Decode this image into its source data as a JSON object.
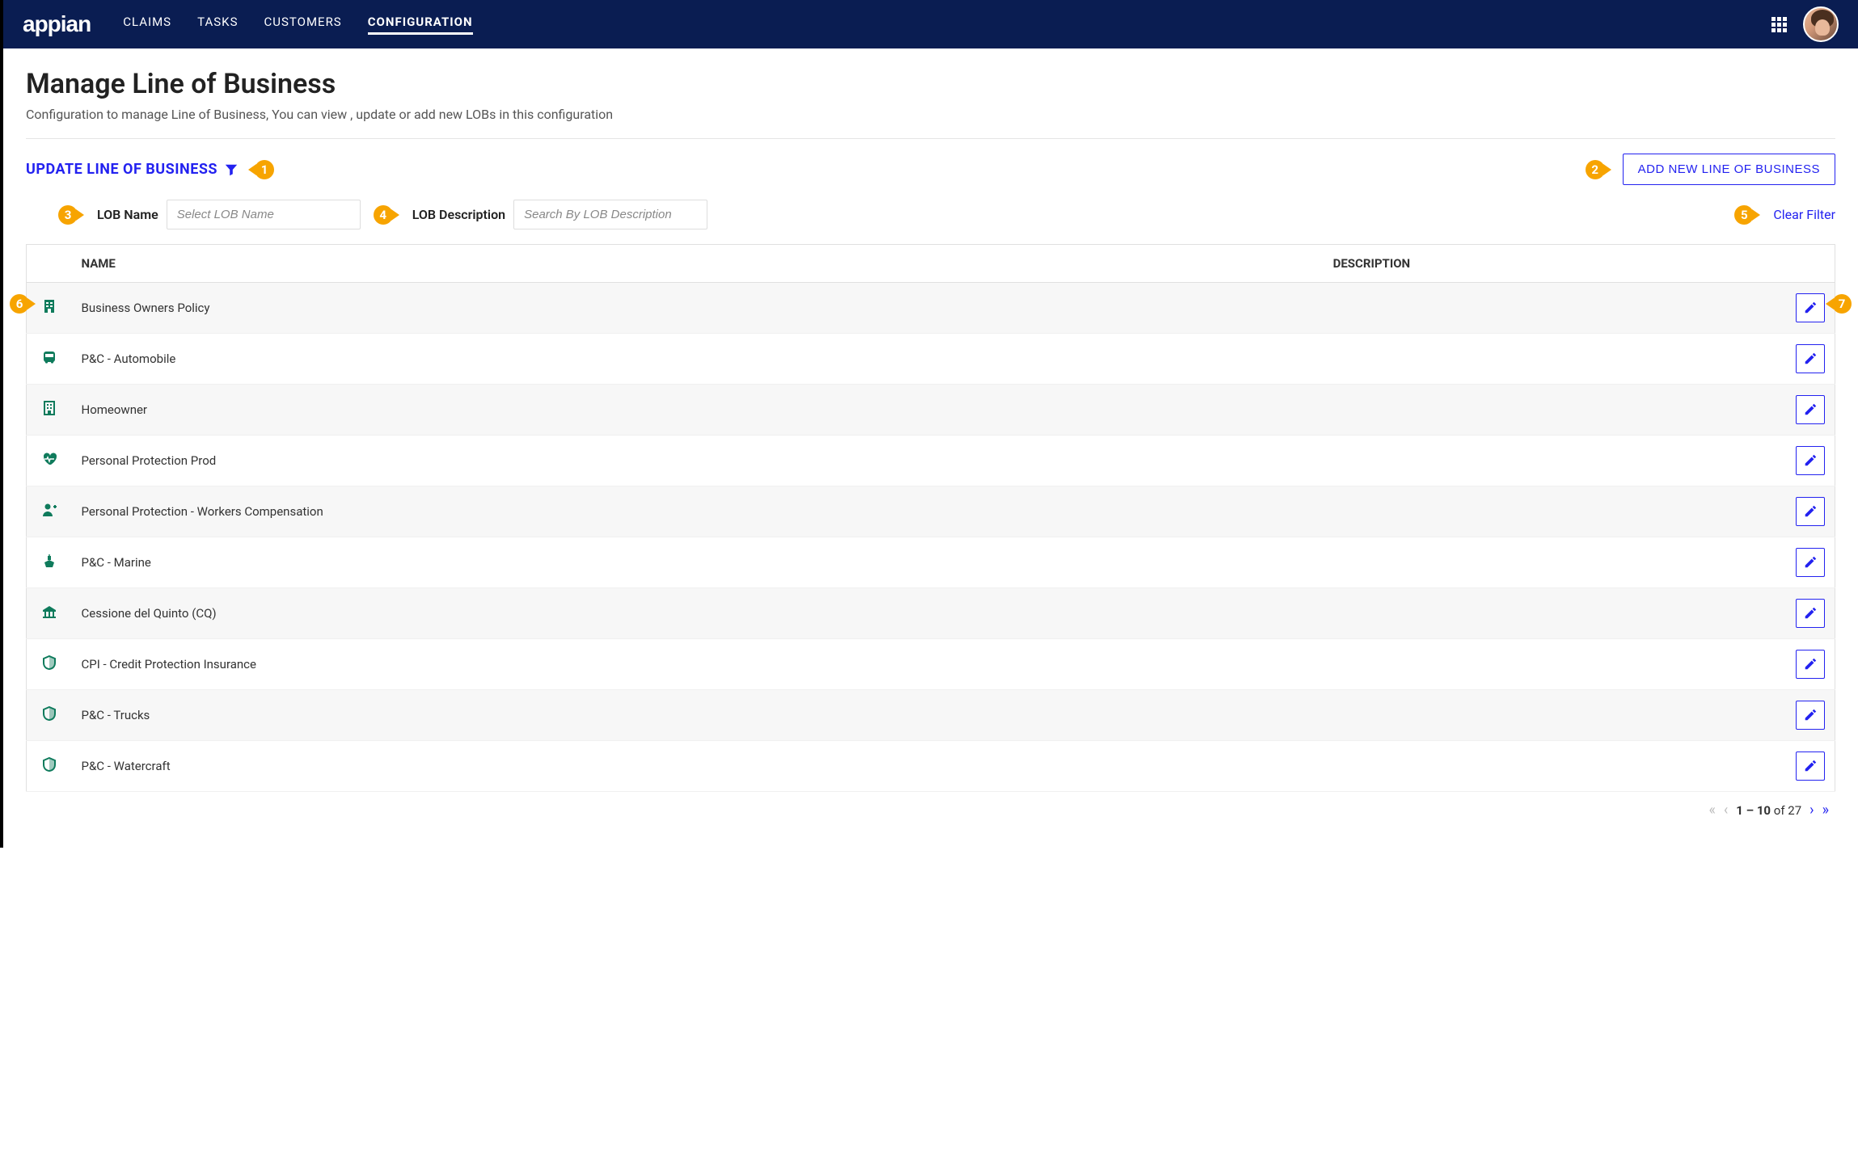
{
  "header": {
    "logo": "appian",
    "nav": [
      {
        "label": "CLAIMS",
        "active": false
      },
      {
        "label": "TASKS",
        "active": false
      },
      {
        "label": "CUSTOMERS",
        "active": false
      },
      {
        "label": "CONFIGURATION",
        "active": true
      }
    ]
  },
  "page": {
    "title": "Manage Line of Business",
    "subtitle": "Configuration to manage Line of Business, You can view , update or add new LOBs in this configuration"
  },
  "section": {
    "title": "UPDATE LINE OF BUSINESS",
    "add_button": "ADD NEW LINE OF BUSINESS"
  },
  "filters": {
    "name_label": "LOB Name",
    "name_placeholder": "Select LOB Name",
    "desc_label": "LOB Description",
    "desc_placeholder": "Search By LOB Description",
    "clear_label": "Clear Filter"
  },
  "table": {
    "headers": {
      "name": "NAME",
      "description": "DESCRIPTION"
    },
    "rows": [
      {
        "icon": "building-solid",
        "name": "Business Owners Policy",
        "description": ""
      },
      {
        "icon": "bus",
        "name": "P&C - Automobile",
        "description": ""
      },
      {
        "icon": "building-outline",
        "name": "Homeowner",
        "description": ""
      },
      {
        "icon": "heartbeat",
        "name": "Personal Protection Prod",
        "description": ""
      },
      {
        "icon": "user-plus",
        "name": "Personal Protection - Workers Compensation",
        "description": ""
      },
      {
        "icon": "ship",
        "name": "P&C - Marine",
        "description": ""
      },
      {
        "icon": "bank",
        "name": "Cessione del Quinto (CQ)",
        "description": ""
      },
      {
        "icon": "shield",
        "name": "CPI - Credit Protection Insurance",
        "description": ""
      },
      {
        "icon": "shield",
        "name": "P&C - Trucks",
        "description": ""
      },
      {
        "icon": "shield",
        "name": "P&C - Watercraft",
        "description": ""
      }
    ]
  },
  "pagination": {
    "range": "1 – 10",
    "of_label": "of",
    "total": "27"
  },
  "callouts": {
    "c1": "1",
    "c2": "2",
    "c3": "3",
    "c4": "4",
    "c5": "5",
    "c6": "6",
    "c7": "7"
  }
}
